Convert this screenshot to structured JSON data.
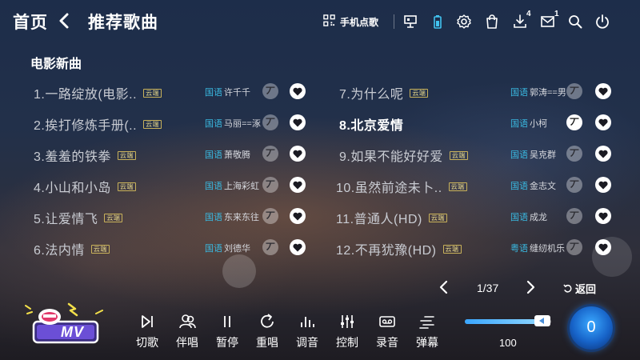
{
  "header": {
    "home": "首页",
    "title": "推荐歌曲",
    "phone_order": "手机点歌",
    "download_count": "4",
    "message_count": "1"
  },
  "section_title": "电影新曲",
  "songs_left": [
    {
      "name": "1.一路绽放(电影..",
      "tag": "云端",
      "lang": "国语",
      "artist": "许千千",
      "active": false
    },
    {
      "name": "2.挨打修炼手册(..",
      "tag": "云端",
      "lang": "国语",
      "artist": "马丽==涿",
      "active": false
    },
    {
      "name": "3.羞羞的铁拳",
      "tag": "云端",
      "lang": "国语",
      "artist": "萧敬腾",
      "active": false
    },
    {
      "name": "4.小山和小岛",
      "tag": "云端",
      "lang": "国语",
      "artist": "上海彩虹",
      "active": false
    },
    {
      "name": "5.让爱情飞",
      "tag": "云端",
      "lang": "国语",
      "artist": "东来东往",
      "active": false
    },
    {
      "name": "6.法内情",
      "tag": "云端",
      "lang": "国语",
      "artist": "刘德华",
      "active": false
    }
  ],
  "songs_right": [
    {
      "name": "7.为什么呢",
      "tag": "云端",
      "lang": "国语",
      "artist": "郭涛==男",
      "active": false
    },
    {
      "name": "8.北京爱情",
      "tag": "",
      "lang": "国语",
      "artist": "小柯",
      "active": true
    },
    {
      "name": "9.如果不能好好爱",
      "tag": "云端",
      "lang": "国语",
      "artist": "吴克群",
      "active": false
    },
    {
      "name": "10.虽然前途未卜..",
      "tag": "云端",
      "lang": "国语",
      "artist": "金志文",
      "active": false
    },
    {
      "name": "11.普通人(HD)",
      "tag": "云端",
      "lang": "国语",
      "artist": "成龙",
      "active": false
    },
    {
      "name": "12.不再犹豫(HD)",
      "tag": "云端",
      "lang": "粤语",
      "artist": "缝纫机乐",
      "active": false
    }
  ],
  "top_btn_glyph": "丆",
  "pagination": {
    "text": "1/37",
    "back": "返回"
  },
  "controls": {
    "skip": "切歌",
    "accompany": "伴唱",
    "pause": "暂停",
    "replay": "重唱",
    "tone": "调音",
    "control": "控制",
    "record": "录音",
    "danmaku": "弹幕"
  },
  "volume": {
    "value": "100",
    "level": 0.9
  },
  "queue_count": "0",
  "logo_text": "MV",
  "colors": {
    "lang": "#39b8e0",
    "tag": "#c9b25a",
    "accent": "#1763c8"
  }
}
